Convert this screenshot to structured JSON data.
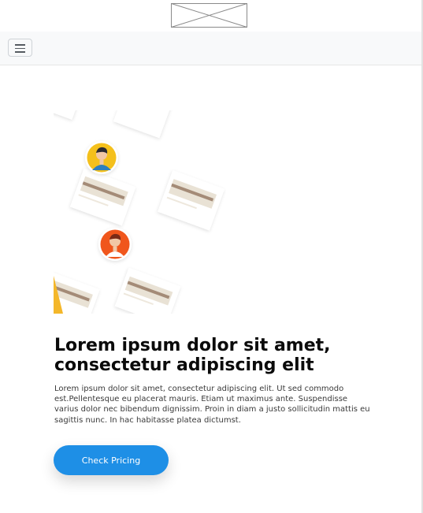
{
  "colors": {
    "navbar_bg": "#f8f9fa",
    "cta_bg": "#1e8fe6",
    "headline": "#0b0b0b",
    "body_text": "#3a3a3a",
    "avatar_yellow": "#f4c01e",
    "avatar_orange": "#f0571e"
  },
  "header": {
    "logo_icon": "image-placeholder-icon",
    "menu_icon": "hamburger-menu-icon"
  },
  "hero": {
    "illustration_icon": "documents-with-user-avatars-illustration",
    "headline": "Lorem ipsum dolor sit amet, consectetur adipiscing elit",
    "body": "Lorem ipsum dolor sit amet, consectetur adipiscing elit. Ut sed commodo est.Pellentesque eu placerat mauris. Etiam ut maximus ante. Suspendisse varius dolor nec bibendum dignissim. Proin in diam a justo sollicitudin mattis eu sagittis nunc. In hac habitasse platea dictumst.",
    "cta_label": "Check Pricing"
  }
}
